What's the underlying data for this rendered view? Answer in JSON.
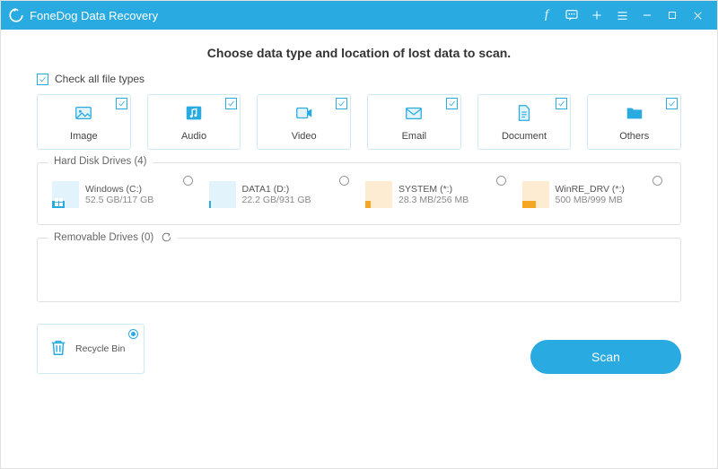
{
  "titlebar": {
    "app_name": "FoneDog Data Recovery"
  },
  "headline": "Choose data type and location of lost data to scan.",
  "checkall_label": "Check all file types",
  "types": [
    {
      "label": "Image",
      "icon": "image"
    },
    {
      "label": "Audio",
      "icon": "audio"
    },
    {
      "label": "Video",
      "icon": "video"
    },
    {
      "label": "Email",
      "icon": "email"
    },
    {
      "label": "Document",
      "icon": "document"
    },
    {
      "label": "Others",
      "icon": "folder"
    }
  ],
  "hdd": {
    "title": "Hard Disk Drives (4)",
    "drives": [
      {
        "name": "Windows (C:)",
        "size": "52.5 GB/117 GB",
        "color": "blue",
        "fill_pct": 45,
        "os_logo": true
      },
      {
        "name": "DATA1 (D:)",
        "size": "22.2 GB/931 GB",
        "color": "blue",
        "fill_pct": 8,
        "os_logo": false
      },
      {
        "name": "SYSTEM (*:)",
        "size": "28.3 MB/256 MB",
        "color": "orange",
        "fill_pct": 20,
        "os_logo": false
      },
      {
        "name": "WinRE_DRV (*:)",
        "size": "500 MB/999 MB",
        "color": "orange",
        "fill_pct": 52,
        "os_logo": false
      }
    ]
  },
  "removable": {
    "title": "Removable Drives (0)"
  },
  "recycle": {
    "label": "Recycle Bin",
    "selected": true
  },
  "scan_label": "Scan",
  "icons": {
    "facebook": "f"
  }
}
